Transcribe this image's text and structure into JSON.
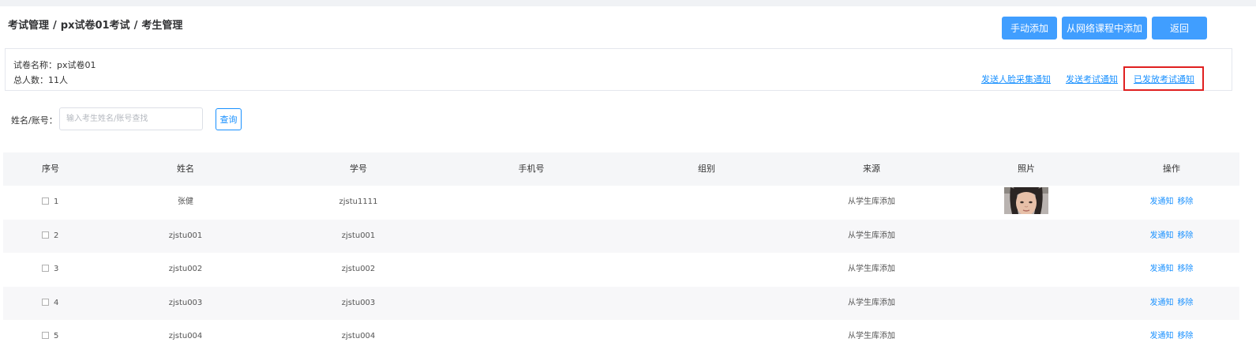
{
  "breadcrumb": [
    "考试管理",
    "px试卷01考试",
    "考生管理"
  ],
  "breadcrumb_sep": "/",
  "actions": {
    "manual_add": "手动添加",
    "add_from_course": "从网络课程中添加",
    "back": "返回"
  },
  "info": {
    "paper_name_label": "试卷名称：",
    "paper_name": "px试卷01",
    "total_label": "总人数：",
    "total": "11人",
    "links": {
      "face_notice": "发送人脸采集通知",
      "send_exam_notice": "发送考试通知",
      "sent_exam_notice": "已发放考试通知"
    }
  },
  "search": {
    "label": "姓名/账号：",
    "placeholder": "输入考生姓名/账号查找",
    "button": "查询"
  },
  "table": {
    "columns": [
      "序号",
      "姓名",
      "学号",
      "手机号",
      "组别",
      "来源",
      "照片",
      "操作"
    ],
    "rows": [
      {
        "no": "1",
        "name": "张健",
        "student_id": "zjstu1111",
        "phone": "",
        "group": "",
        "source": "从学生库添加",
        "has_photo": true
      },
      {
        "no": "2",
        "name": "zjstu001",
        "student_id": "zjstu001",
        "phone": "",
        "group": "",
        "source": "从学生库添加",
        "has_photo": false
      },
      {
        "no": "3",
        "name": "zjstu002",
        "student_id": "zjstu002",
        "phone": "",
        "group": "",
        "source": "从学生库添加",
        "has_photo": false
      },
      {
        "no": "4",
        "name": "zjstu003",
        "student_id": "zjstu003",
        "phone": "",
        "group": "",
        "source": "从学生库添加",
        "has_photo": false
      },
      {
        "no": "5",
        "name": "zjstu004",
        "student_id": "zjstu004",
        "phone": "",
        "group": "",
        "source": "从学生库添加",
        "has_photo": false
      }
    ],
    "op_notify": "发通知",
    "op_remove": "移除"
  },
  "colors": {
    "primary": "#409eff",
    "link": "#1890ff",
    "highlight": "#e02020",
    "header_bg": "#f5f6f8"
  }
}
